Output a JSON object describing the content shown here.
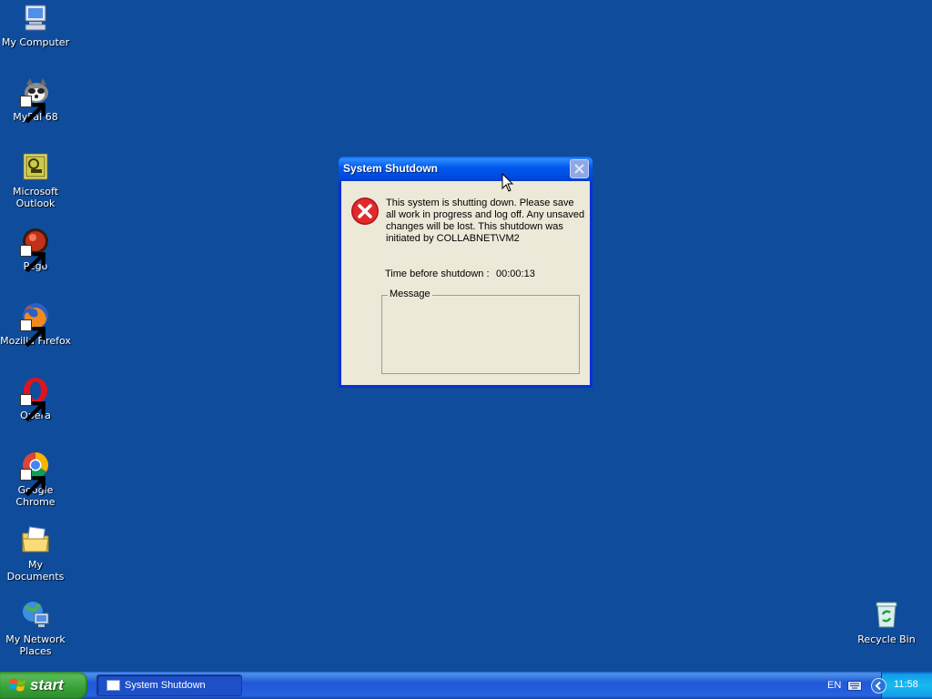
{
  "desktop": {
    "icons": [
      {
        "label": "My Computer",
        "icon": "my-computer-icon"
      },
      {
        "label": "MyPal 68",
        "icon": "mypal-icon"
      },
      {
        "label": "Microsoft Outlook",
        "icon": "outlook-icon"
      },
      {
        "label": "Pego",
        "icon": "pego-icon"
      },
      {
        "label": "Mozilla Firefox",
        "icon": "firefox-icon"
      },
      {
        "label": "Opera",
        "icon": "opera-icon"
      },
      {
        "label": "Google Chrome",
        "icon": "chrome-icon"
      },
      {
        "label": "My Documents",
        "icon": "my-documents-icon"
      },
      {
        "label": "My Network Places",
        "icon": "network-places-icon"
      },
      {
        "label": "Recycle Bin",
        "icon": "recycle-bin-icon"
      }
    ],
    "background_color": "#0f4c9c"
  },
  "dialog": {
    "title": "System Shutdown",
    "message": "This system is shutting down. Please save all work in progress and log off. Any unsaved changes will be lost. This shutdown was initiated by COLLABNET\\VM2",
    "time_label": "Time before shutdown :",
    "time_value": "00:00:13",
    "message_group_label": "Message",
    "message_body": ""
  },
  "taskbar": {
    "start_label": "start",
    "tasks": [
      {
        "label": "System Shutdown"
      }
    ],
    "language": "EN",
    "clock": "11:58"
  }
}
